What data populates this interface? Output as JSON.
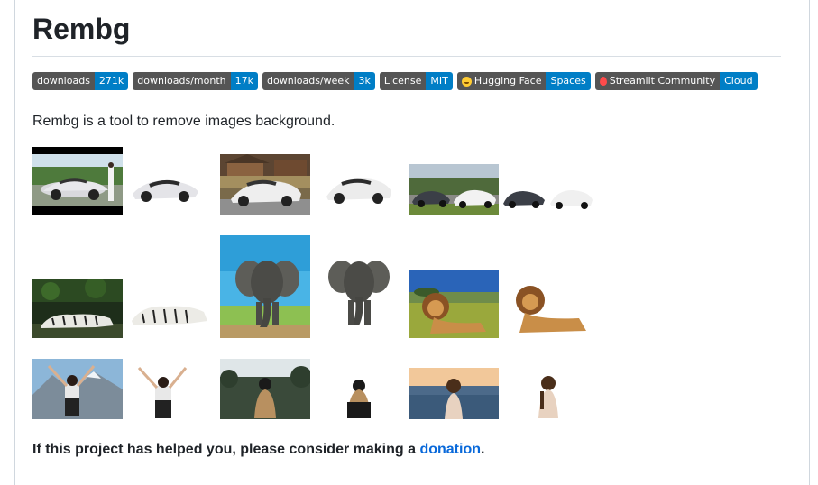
{
  "title": "Rembg",
  "badges": [
    {
      "label": "downloads",
      "value": "271k",
      "icon": ""
    },
    {
      "label": "downloads/month",
      "value": "17k",
      "icon": ""
    },
    {
      "label": "downloads/week",
      "value": "3k",
      "icon": ""
    },
    {
      "label": "License",
      "value": "MIT",
      "icon": ""
    },
    {
      "label": "Hugging Face",
      "value": "Spaces",
      "icon": "hugging-face-icon"
    },
    {
      "label": "Streamlit Community",
      "value": "Cloud",
      "icon": "streamlit-icon"
    }
  ],
  "intro": "Rembg is a tool to remove images background.",
  "gallery": {
    "rows": [
      [
        "car-1-original",
        "car-1-removed",
        "car-2-original",
        "car-2-removed",
        "car-3-original",
        "car-3-removed"
      ],
      [
        "animal-1-original",
        "animal-1-removed",
        "animal-2-original",
        "animal-2-removed",
        "animal-3-original",
        "animal-3-removed"
      ],
      [
        "girl-1-original",
        "girl-1-removed",
        "girl-2-original",
        "girl-2-removed",
        "girl-3-original",
        "girl-3-removed"
      ]
    ]
  },
  "footer": {
    "text": "If this project has helped you, please consider making a ",
    "link": "donation",
    "end": "."
  },
  "colors": {
    "badge_left": "#555555",
    "badge_right": "#007ec6",
    "link": "#0969da"
  }
}
